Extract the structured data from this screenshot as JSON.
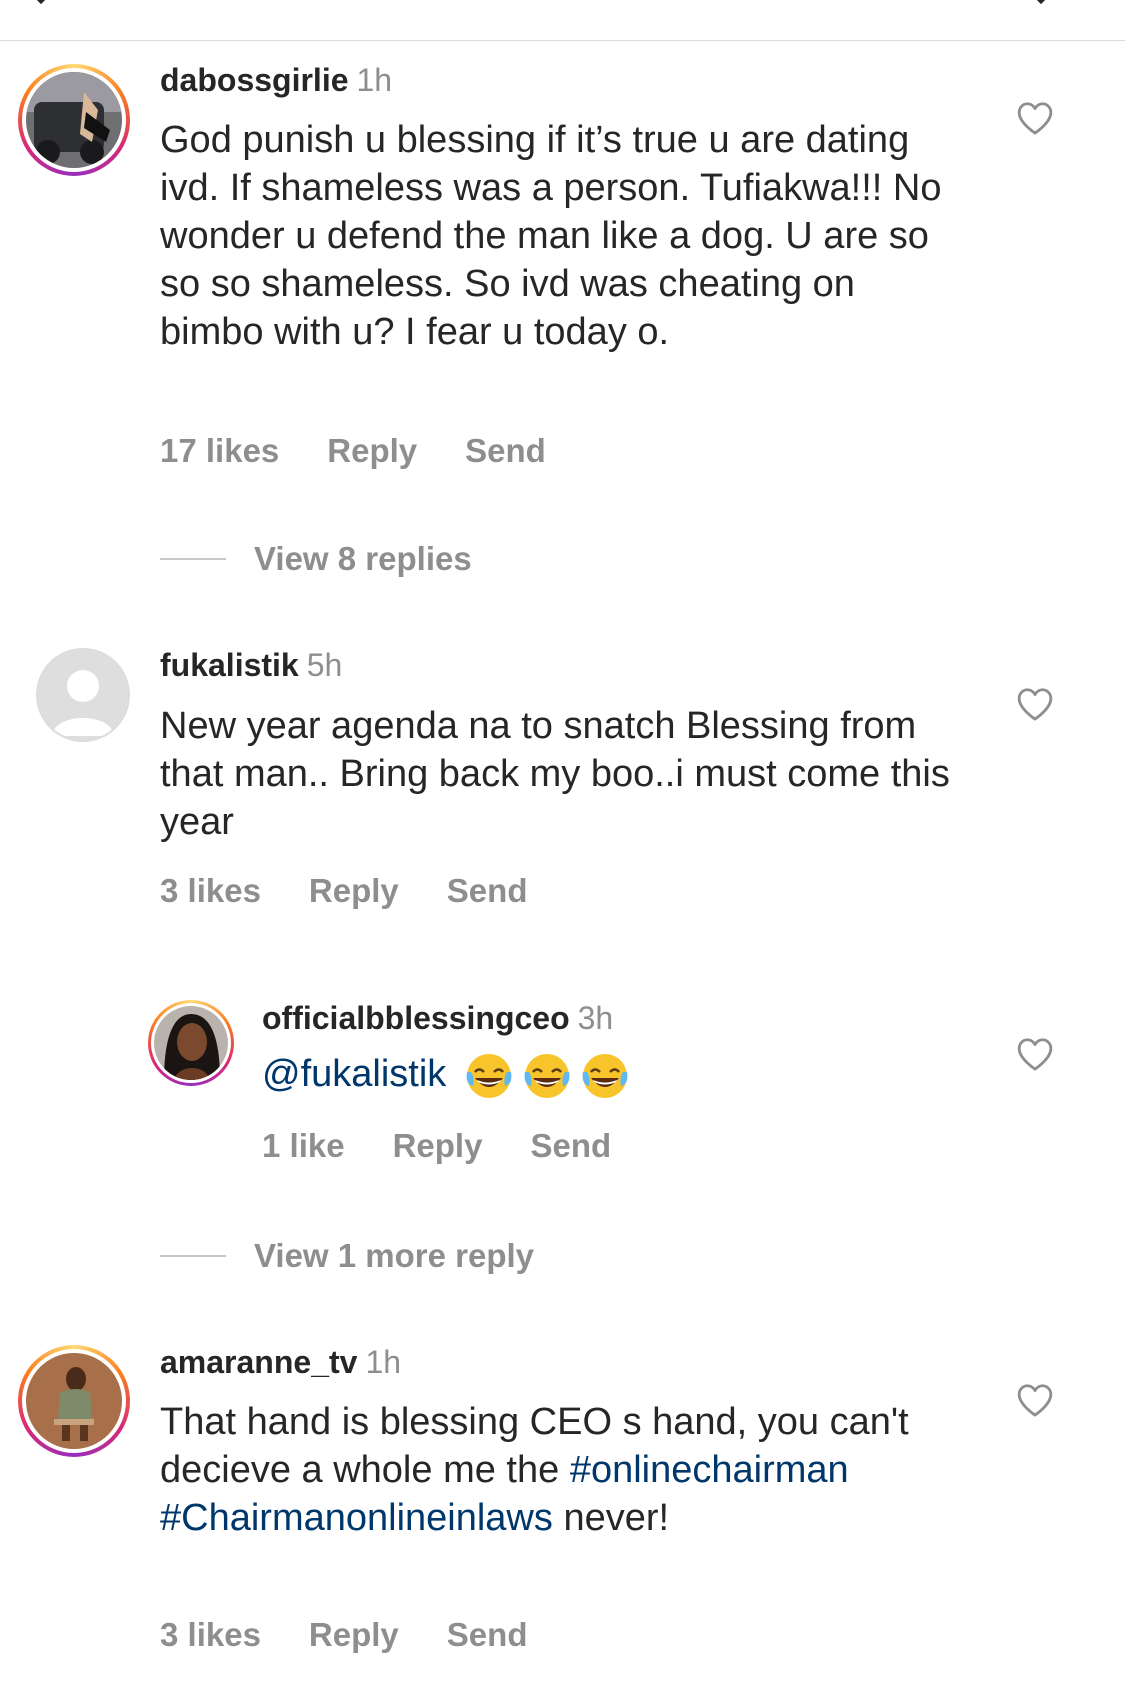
{
  "comments": [
    {
      "username": "dabossgirlie",
      "time": "1h",
      "text": "God punish u blessing if it’s true u are dating ivd. If shameless was a person. Tufiakwa!!! No wonder u defend the man like a dog. U are so so so shameless. So ivd was cheating on bimbo with u? I fear u today o.",
      "likes": "17 likes",
      "reply": "Reply",
      "send": "Send",
      "view_replies": "View 8 replies"
    },
    {
      "username": "fukalistik",
      "time": "5h",
      "text": "New year agenda na to snatch Blessing from that man.. Bring back my boo..i must come this year",
      "likes": "3 likes",
      "reply": "Reply",
      "send": "Send"
    },
    {
      "username": "officialbblessingceo",
      "time": "3h",
      "mention": "@fukalistik",
      "likes": "1 like",
      "reply": "Reply",
      "send": "Send",
      "view_replies": "View 1 more reply"
    },
    {
      "username": "amaranne_tv",
      "time": "1h",
      "text_part1": "That hand is blessing CEO s hand, you can't decieve a whole me the",
      "hashtag1": "#onlinechairman",
      "hashtag2": "#Chairmanonlineinlaws",
      "text_part2": "never!",
      "likes": "3 likes",
      "reply": "Reply",
      "send": "Send"
    }
  ],
  "icons": {
    "heart": "heart-outline-icon",
    "emoji": "face-with-tears-of-joy-icon"
  },
  "colors": {
    "text": "#262626",
    "secondary": "#8e8e8e",
    "link": "#00376b",
    "divider": "#dbdbdb"
  }
}
